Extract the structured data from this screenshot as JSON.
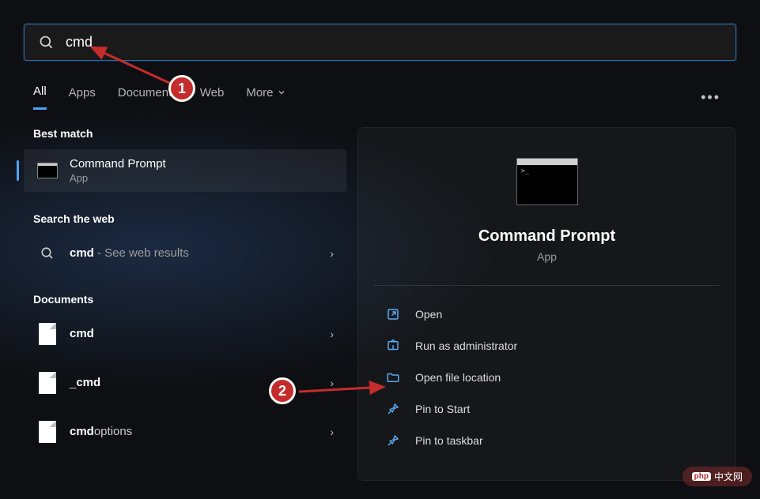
{
  "search": {
    "value": "cmd"
  },
  "tabs": {
    "all": "All",
    "apps": "Apps",
    "documents": "Documents",
    "web": "Web",
    "more": "More"
  },
  "sections": {
    "best_match": "Best match",
    "search_web": "Search the web",
    "documents": "Documents"
  },
  "best_match": {
    "title": "Command Prompt",
    "sub": "App"
  },
  "web_result": {
    "bold": "cmd",
    "suffix": " - See web results"
  },
  "docs": {
    "d1_bold": "cmd",
    "d2_pre": "_",
    "d2_bold": "cmd",
    "d3_bold": "cmd",
    "d3_suf": "options"
  },
  "preview": {
    "title": "Command Prompt",
    "sub": "App"
  },
  "actions": {
    "open": "Open",
    "admin": "Run as administrator",
    "location": "Open file location",
    "pinstart": "Pin to Start",
    "pintaskbar": "Pin to taskbar"
  },
  "anno": {
    "one": "1",
    "two": "2"
  },
  "watermark": "php 中文网"
}
